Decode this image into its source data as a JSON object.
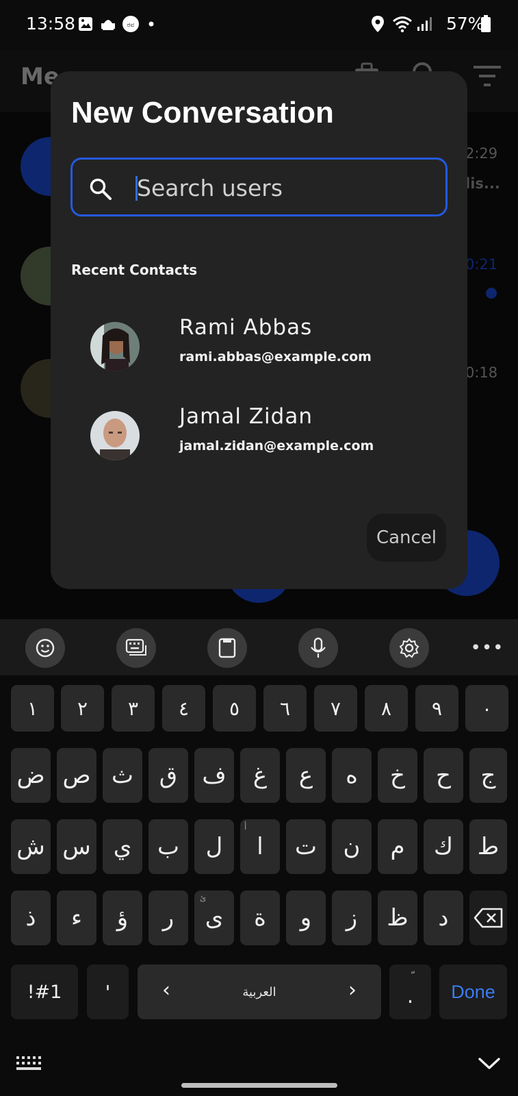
{
  "status_bar": {
    "time": "13:58",
    "battery": "57%",
    "icons": [
      "image-icon",
      "notification-icon",
      "app-icon",
      "dot-icon",
      "location-icon",
      "wifi-icon",
      "signal-icon",
      "battery-icon"
    ]
  },
  "background_app": {
    "title": "Me",
    "times": [
      "2:29",
      "0:21",
      "0:18"
    ],
    "preview_snippet": "lis..."
  },
  "dialog": {
    "title": "New Conversation",
    "search": {
      "placeholder": "Search users",
      "value": ""
    },
    "section_label": "Recent Contacts",
    "contacts": [
      {
        "name": "Rami Abbas",
        "email": "rami.abbas@example.com"
      },
      {
        "name": "Jamal Zidan",
        "email": "jamal.zidan@example.com"
      }
    ],
    "cancel_label": "Cancel"
  },
  "keyboard": {
    "toolbar": [
      "emoji-icon",
      "keyboard-icon",
      "clipboard-icon",
      "mic-icon",
      "settings-icon",
      "more-icon"
    ],
    "row_numbers": [
      "١",
      "٢",
      "٣",
      "٤",
      "٥",
      "٦",
      "٧",
      "٨",
      "٩",
      "٠"
    ],
    "row1": [
      "ض",
      "ص",
      "ث",
      "ق",
      "ف",
      "غ",
      "ع",
      "ه",
      "خ",
      "ح",
      "ج"
    ],
    "row2": [
      "ش",
      "س",
      "ي",
      "ب",
      "ل",
      "ا",
      "ت",
      "ن",
      "م",
      "ك",
      "ط"
    ],
    "row2_hints": [
      "",
      "",
      "",
      "",
      "",
      "أ",
      "",
      "",
      "",
      "",
      ""
    ],
    "row3": [
      "ذ",
      "ء",
      "ؤ",
      "ر",
      "ى",
      "ة",
      "و",
      "ز",
      "ظ",
      "د"
    ],
    "row3_hints": [
      "",
      "",
      "",
      "",
      "ئ",
      "",
      "",
      "",
      "",
      ""
    ],
    "symbols_label": "!#1",
    "apostrophe": "'",
    "space_label": "العربية",
    "space_left": "‹",
    "space_right": "›",
    "period": ".",
    "period_hint": "ّ",
    "done_label": "Done"
  },
  "colors": {
    "accent": "#2459e0",
    "dialog_bg": "#232323",
    "done": "#3b7cf0"
  }
}
